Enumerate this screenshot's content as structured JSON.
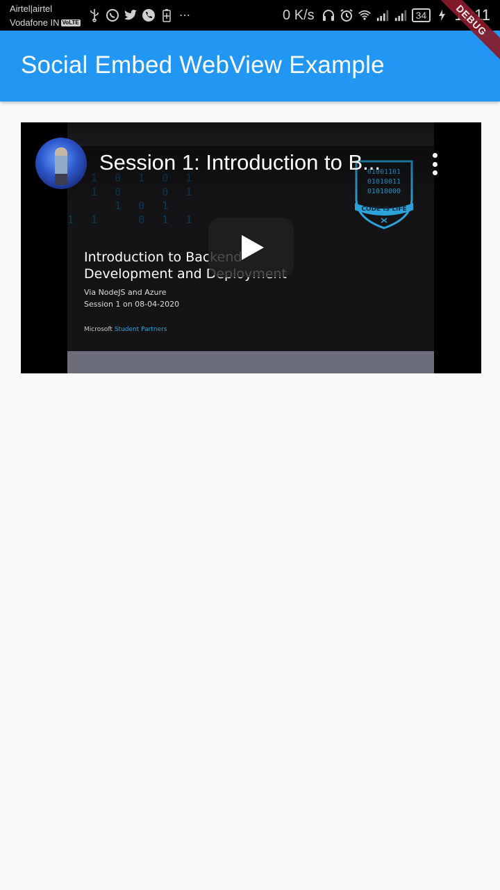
{
  "status_bar": {
    "carrier_1": "Airtel|airtel",
    "carrier_2": "Vodafone IN",
    "volte": "VoLTE",
    "net_speed": "0 K/s",
    "battery": "34",
    "time": "11:11",
    "debug_banner": "DEBUG"
  },
  "app_bar": {
    "title": "Social Embed WebView Example"
  },
  "video": {
    "title": "Session 1: Introduction to B...",
    "slide": {
      "heading_line1": "Introduction to Backend",
      "heading_line2": "Development and Deployment",
      "sub_line1": "Via NodeJS and Azure",
      "sub_line2": "Session 1 on 08-04-2020",
      "footer_brand": "Microsoft",
      "footer_accent": "Student Partners",
      "badge_text": "CODE IS LIFE",
      "badge_bits": [
        "01001101",
        "01010011",
        "01010000"
      ]
    }
  },
  "colors": {
    "app_bar": "#2196f3",
    "background": "#fafafa",
    "badge_accent": "#2ba3d8"
  }
}
